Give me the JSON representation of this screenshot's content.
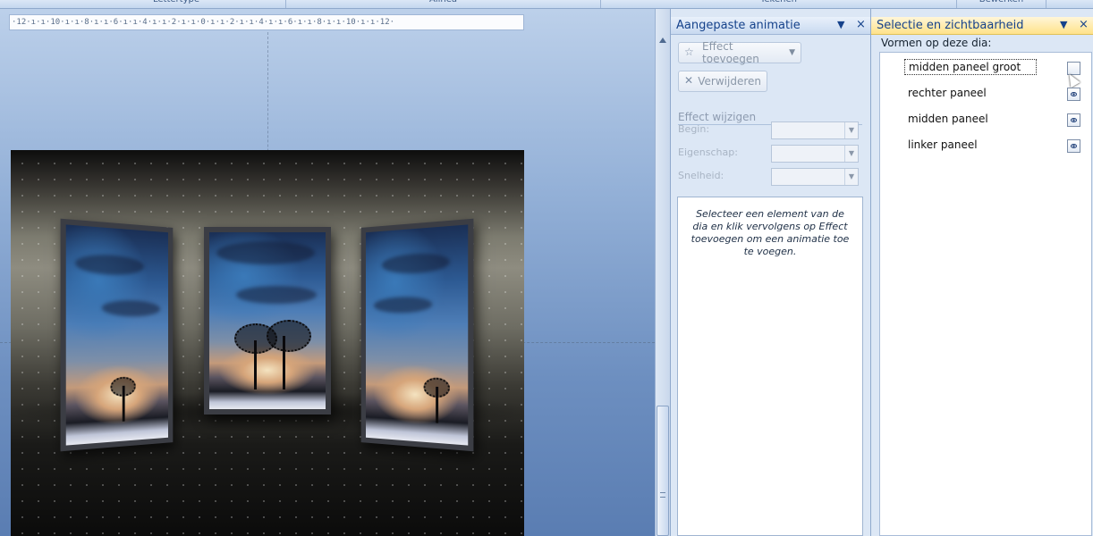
{
  "ribbon": {
    "groups": [
      "Lettertype",
      "Alinea",
      "Tekenen",
      "Bewerken"
    ]
  },
  "ruler": {
    "text": "·12·ı·ı·10·ı·ı·8·ı·ı·6·ı·ı·4·ı·ı·2·ı·ı·0·ı·ı·2·ı·ı·4·ı·ı·6·ı·ı·8·ı·ı·10·ı·ı·12·"
  },
  "animation_pane": {
    "title": "Aangepaste animatie",
    "add_effect": "Effect toevoegen",
    "remove": "Verwijderen",
    "modify_section": "Effect wijzigen",
    "start_label": "Begin:",
    "property_label": "Eigenschap:",
    "speed_label": "Snelheid:",
    "start_value": "",
    "property_value": "",
    "speed_value": "",
    "info_text": "Selecteer een element van de dia en klik vervolgens op Effect toevoegen om een animatie toe te voegen."
  },
  "selection_pane": {
    "title": "Selectie en zichtbaarheid",
    "subtitle": "Vormen op deze dia:",
    "shapes": [
      {
        "name": "midden paneel groot",
        "visible": false,
        "selected": true
      },
      {
        "name": "rechter paneel",
        "visible": true,
        "selected": false
      },
      {
        "name": "midden paneel",
        "visible": true,
        "selected": false
      },
      {
        "name": "linker paneel",
        "visible": true,
        "selected": false
      }
    ]
  },
  "colors": {
    "pane_background": "#dce7f5",
    "selection_header": "#ffe28a",
    "pane_title_text": "#15428b"
  }
}
